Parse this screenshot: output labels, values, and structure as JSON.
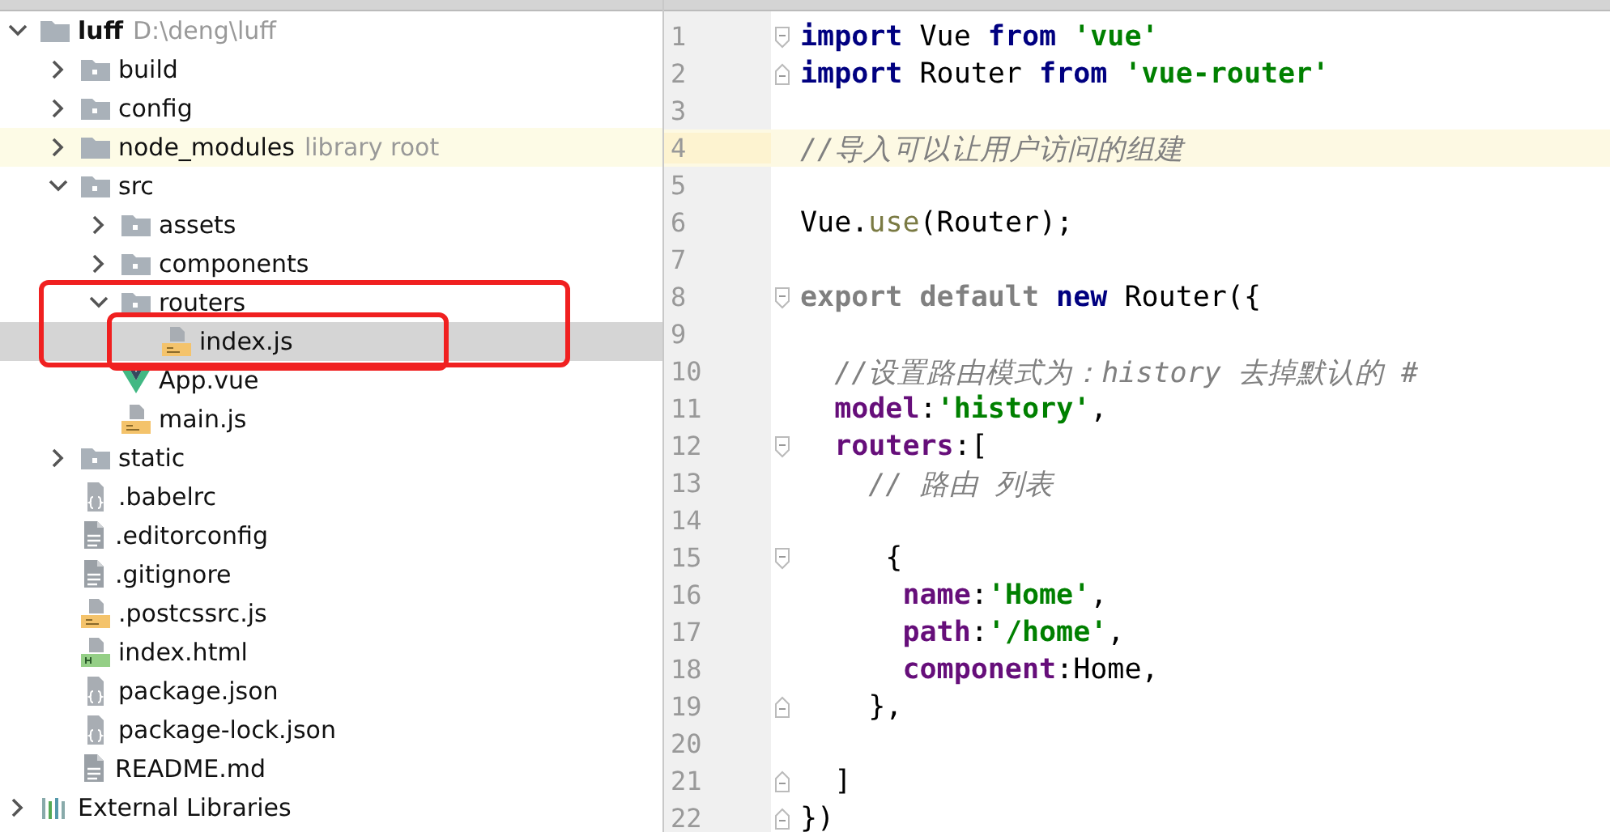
{
  "project_tree": [
    {
      "label": "luff",
      "detail": "D:\\deng\\luff",
      "kind": "root",
      "expanded": true,
      "selected": false,
      "highlighted": false,
      "outlined": false,
      "children": [
        {
          "label": "build",
          "kind": "folder",
          "expanded": false,
          "selected": false,
          "highlighted": false,
          "outlined": false
        },
        {
          "label": "config",
          "kind": "folder",
          "expanded": false,
          "selected": false,
          "highlighted": false,
          "outlined": false
        },
        {
          "label": "node_modules",
          "detail": "library root",
          "kind": "folder-plain",
          "expanded": false,
          "selected": false,
          "highlighted": true,
          "outlined": false
        },
        {
          "label": "src",
          "kind": "folder",
          "expanded": true,
          "selected": false,
          "highlighted": false,
          "outlined": false,
          "children": [
            {
              "label": "assets",
              "kind": "folder",
              "expanded": false,
              "selected": false,
              "highlighted": false,
              "outlined": false
            },
            {
              "label": "components",
              "kind": "folder",
              "expanded": false,
              "selected": false,
              "highlighted": false,
              "outlined": false
            },
            {
              "label": "routers",
              "kind": "folder",
              "expanded": true,
              "selected": false,
              "highlighted": false,
              "outlined": true,
              "children": [
                {
                  "label": "index.js",
                  "kind": "js",
                  "selected": true,
                  "highlighted": false,
                  "outlined": true
                }
              ]
            },
            {
              "label": "App.vue",
              "kind": "vue",
              "selected": false,
              "highlighted": false,
              "outlined": false
            },
            {
              "label": "main.js",
              "kind": "js",
              "selected": false,
              "highlighted": false,
              "outlined": false
            }
          ]
        },
        {
          "label": "static",
          "kind": "folder",
          "expanded": false,
          "selected": false,
          "highlighted": false,
          "outlined": false
        },
        {
          "label": ".babelrc",
          "kind": "json",
          "selected": false,
          "highlighted": false,
          "outlined": false
        },
        {
          "label": ".editorconfig",
          "kind": "text",
          "selected": false,
          "highlighted": false,
          "outlined": false
        },
        {
          "label": ".gitignore",
          "kind": "text",
          "selected": false,
          "highlighted": false,
          "outlined": false
        },
        {
          "label": ".postcssrc.js",
          "kind": "js",
          "selected": false,
          "highlighted": false,
          "outlined": false
        },
        {
          "label": "index.html",
          "kind": "html",
          "selected": false,
          "highlighted": false,
          "outlined": false
        },
        {
          "label": "package.json",
          "kind": "json",
          "selected": false,
          "highlighted": false,
          "outlined": false
        },
        {
          "label": "package-lock.json",
          "kind": "json",
          "selected": false,
          "highlighted": false,
          "outlined": false
        },
        {
          "label": "README.md",
          "kind": "text",
          "selected": false,
          "highlighted": false,
          "outlined": false
        }
      ]
    },
    {
      "label": "External Libraries",
      "kind": "libraries",
      "expanded": false,
      "selected": false,
      "highlighted": false,
      "outlined": false
    }
  ],
  "editor": {
    "lines": [
      {
        "number": "1",
        "fold_start": true,
        "fold_end": false,
        "current": false,
        "tokens": [
          {
            "kind": "keyword",
            "text": "import"
          },
          {
            "kind": "plain",
            "text": " Vue "
          },
          {
            "kind": "keyword",
            "text": "from"
          },
          {
            "kind": "string",
            "text": " 'vue'"
          }
        ]
      },
      {
        "number": "2",
        "fold_start": false,
        "fold_end": true,
        "current": false,
        "tokens": [
          {
            "kind": "keyword",
            "text": "import"
          },
          {
            "kind": "plain",
            "text": " Router "
          },
          {
            "kind": "keyword",
            "text": "from"
          },
          {
            "kind": "string",
            "text": " 'vue-router'"
          }
        ]
      },
      {
        "number": "3",
        "fold_start": false,
        "fold_end": false,
        "current": false
      },
      {
        "number": "4",
        "fold_start": false,
        "fold_end": false,
        "current": true,
        "tokens": [
          {
            "kind": "comment",
            "text": "//导入可以让用户访问的组建"
          }
        ]
      },
      {
        "number": "5",
        "fold_start": false,
        "fold_end": false,
        "current": false
      },
      {
        "number": "6",
        "fold_start": false,
        "fold_end": false,
        "current": false,
        "tokens": [
          {
            "kind": "plain",
            "text": "Vue."
          },
          {
            "kind": "method",
            "text": "use"
          },
          {
            "kind": "plain",
            "text": "(Router);"
          }
        ]
      },
      {
        "number": "7",
        "fold_start": false,
        "fold_end": false,
        "current": false
      },
      {
        "number": "8",
        "fold_start": true,
        "fold_end": false,
        "current": false,
        "tokens": [
          {
            "kind": "unused",
            "text": "export default"
          },
          {
            "kind": "keyword",
            "text": " new"
          },
          {
            "kind": "plain",
            "text": " Router({"
          }
        ]
      },
      {
        "number": "9",
        "fold_start": false,
        "fold_end": false,
        "current": false
      },
      {
        "number": "10",
        "fold_start": false,
        "fold_end": false,
        "current": false,
        "tokens": [
          {
            "kind": "comment",
            "text": "  //设置路由模式为：history 去掉默认的 #"
          }
        ]
      },
      {
        "number": "11",
        "fold_start": false,
        "fold_end": false,
        "current": false,
        "tokens": [
          {
            "kind": "property",
            "text": "  model"
          },
          {
            "kind": "plain",
            "text": ":"
          },
          {
            "kind": "string",
            "text": "'history'"
          },
          {
            "kind": "plain",
            "text": ","
          }
        ]
      },
      {
        "number": "12",
        "fold_start": true,
        "fold_end": false,
        "current": false,
        "tokens": [
          {
            "kind": "property",
            "text": "  routers"
          },
          {
            "kind": "plain",
            "text": ":["
          }
        ]
      },
      {
        "number": "13",
        "fold_start": false,
        "fold_end": false,
        "current": false,
        "tokens": [
          {
            "kind": "comment",
            "text": "    // 路由 列表"
          }
        ]
      },
      {
        "number": "14",
        "fold_start": false,
        "fold_end": false,
        "current": false
      },
      {
        "number": "15",
        "fold_start": true,
        "fold_end": false,
        "current": false,
        "tokens": [
          {
            "kind": "plain",
            "text": "     {"
          }
        ]
      },
      {
        "number": "16",
        "fold_start": false,
        "fold_end": false,
        "current": false,
        "tokens": [
          {
            "kind": "property",
            "text": "      name"
          },
          {
            "kind": "plain",
            "text": ":"
          },
          {
            "kind": "string",
            "text": "'Home'"
          },
          {
            "kind": "plain",
            "text": ","
          }
        ]
      },
      {
        "number": "17",
        "fold_start": false,
        "fold_end": false,
        "current": false,
        "tokens": [
          {
            "kind": "property",
            "text": "      path"
          },
          {
            "kind": "plain",
            "text": ":"
          },
          {
            "kind": "string",
            "text": "'/home'"
          },
          {
            "kind": "plain",
            "text": ","
          }
        ]
      },
      {
        "number": "18",
        "fold_start": false,
        "fold_end": false,
        "current": false,
        "tokens": [
          {
            "kind": "property",
            "text": "      component"
          },
          {
            "kind": "plain",
            "text": ":Home,"
          }
        ]
      },
      {
        "number": "19",
        "fold_start": false,
        "fold_end": true,
        "current": false,
        "tokens": [
          {
            "kind": "plain",
            "text": "    },"
          }
        ]
      },
      {
        "number": "20",
        "fold_start": false,
        "fold_end": false,
        "current": false
      },
      {
        "number": "21",
        "fold_start": false,
        "fold_end": true,
        "current": false,
        "tokens": [
          {
            "kind": "plain",
            "text": "  ]"
          }
        ]
      },
      {
        "number": "22",
        "fold_start": false,
        "fold_end": true,
        "current": false,
        "tokens": [
          {
            "kind": "plain",
            "text": "})"
          }
        ]
      }
    ]
  }
}
